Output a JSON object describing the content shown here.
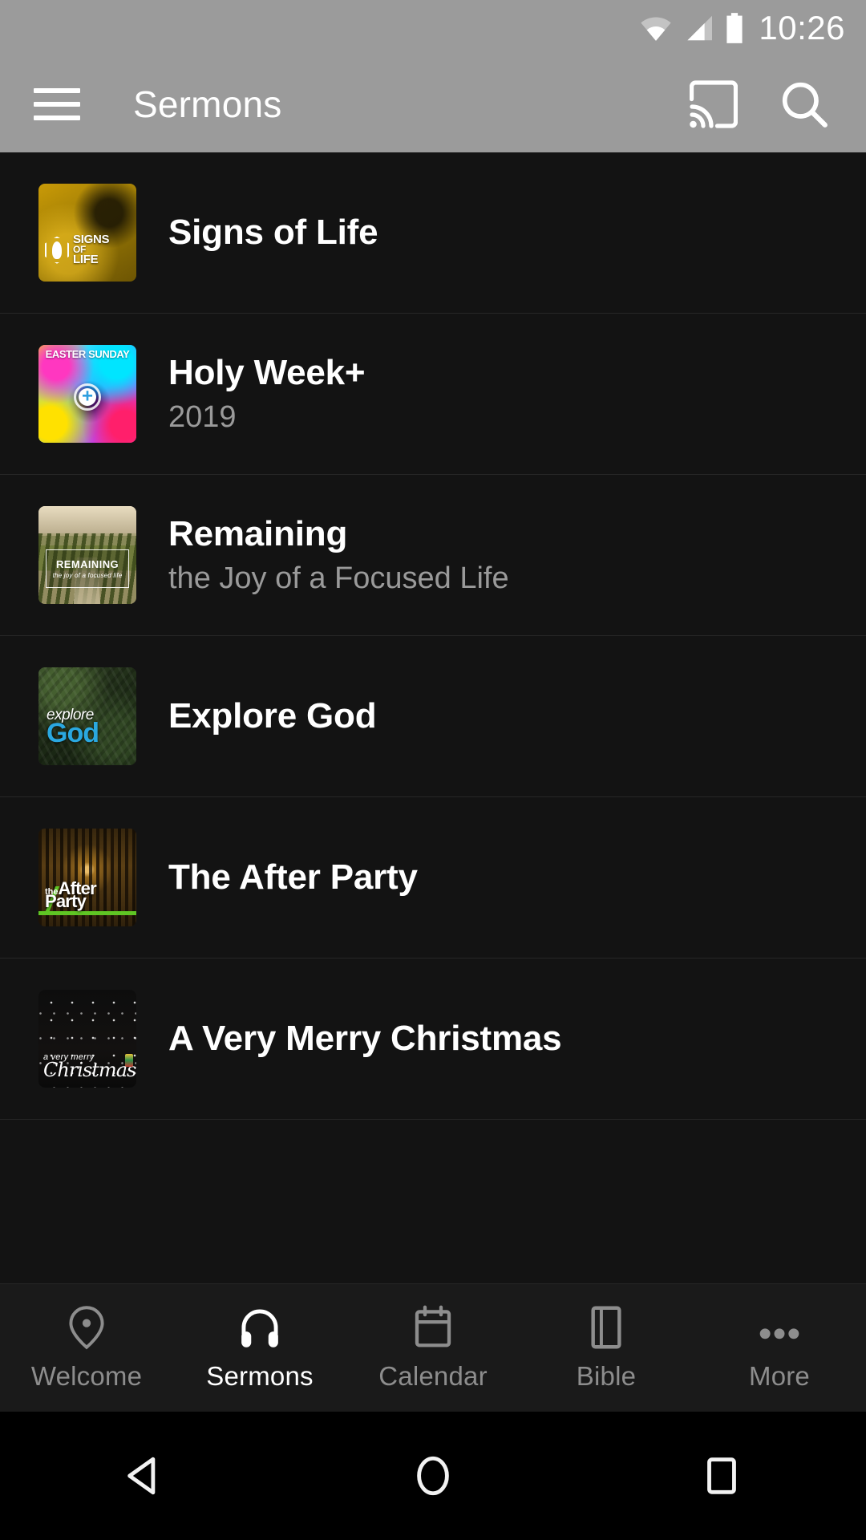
{
  "status_bar": {
    "time": "10:26",
    "icons": [
      "wifi-icon",
      "cellular-signal-icon",
      "battery-icon"
    ]
  },
  "app_bar": {
    "title": "Sermons",
    "menu_icon": "hamburger-menu-icon",
    "cast_icon": "cast-icon",
    "search_icon": "search-icon"
  },
  "colors": {
    "appbar_background": "#9b9b9b",
    "list_background": "#131313",
    "nav_background": "#1a1a1a",
    "active_tab": "#ffffff",
    "inactive_tab": "#8d8d8d",
    "divider": "#272727",
    "subtitle": "#9a9a9a"
  },
  "sermon_series": [
    {
      "title": "Signs of Life",
      "subtitle": "",
      "thumbnail_text": {
        "line1": "SIGNS",
        "line2": "OF",
        "line3": "LIFE"
      },
      "thumbnail_alt": "signs-of-life-artwork"
    },
    {
      "title": "Holy Week+",
      "subtitle": "2019",
      "thumbnail_text": {
        "line1": "EASTER SUNDAY"
      },
      "thumbnail_alt": "holy-week-artwork"
    },
    {
      "title": "Remaining",
      "subtitle": "the Joy of a Focused Life",
      "thumbnail_text": {
        "line1": "REMAINING",
        "line2": "the joy of a focused life"
      },
      "thumbnail_alt": "remaining-artwork"
    },
    {
      "title": "Explore God",
      "subtitle": "",
      "thumbnail_text": {
        "line1": "explore",
        "line2": "God"
      },
      "thumbnail_alt": "explore-god-artwork"
    },
    {
      "title": "The After Party",
      "subtitle": "",
      "thumbnail_text": {
        "line1": "the",
        "line2": "After",
        "line3": "Party"
      },
      "thumbnail_alt": "the-after-party-artwork"
    },
    {
      "title": "A Very Merry Christmas",
      "subtitle": "",
      "thumbnail_text": {
        "line1": "a very merry",
        "line2": "Christmas"
      },
      "thumbnail_alt": "a-very-merry-christmas-artwork"
    }
  ],
  "bottom_nav": {
    "active_index": 1,
    "items": [
      {
        "label": "Welcome",
        "icon": "location-pin-icon"
      },
      {
        "label": "Sermons",
        "icon": "headphones-icon"
      },
      {
        "label": "Calendar",
        "icon": "calendar-icon"
      },
      {
        "label": "Bible",
        "icon": "book-icon"
      },
      {
        "label": "More",
        "icon": "more-dots-icon"
      }
    ]
  },
  "system_nav": {
    "back": "back-triangle-icon",
    "home": "home-circle-icon",
    "recents": "recents-square-icon"
  }
}
